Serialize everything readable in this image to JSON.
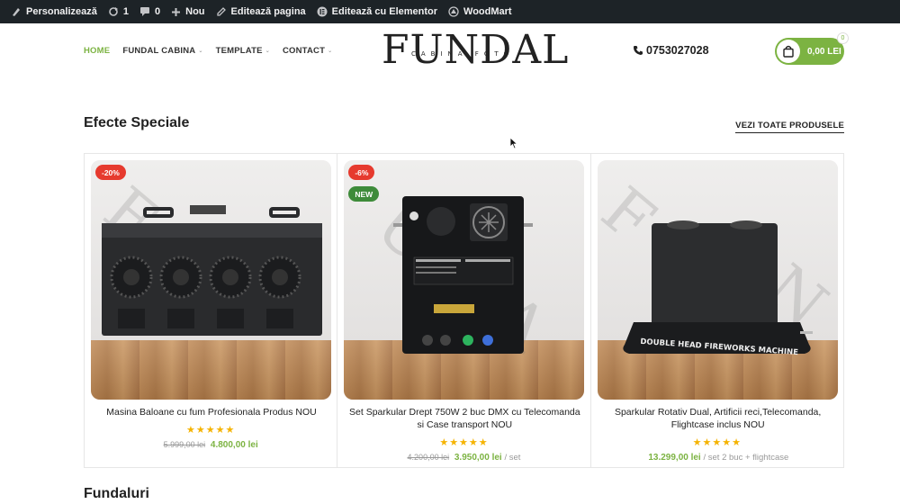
{
  "adminbar": {
    "customize": "Personalizează",
    "updates_count": "1",
    "comments_count": "0",
    "new": "Nou",
    "edit_page": "Editează pagina",
    "edit_elementor": "Editează cu Elementor",
    "woodmart": "WoodMart"
  },
  "nav": {
    "items": [
      {
        "label": "HOME",
        "active": true
      },
      {
        "label": "FUNDAL CABINA",
        "has_dropdown": true
      },
      {
        "label": "TEMPLATE",
        "has_dropdown": true
      },
      {
        "label": "CONTACT",
        "has_dropdown": true
      }
    ]
  },
  "logo": {
    "main": "FUNDAL",
    "sub": "CABINA FOTO"
  },
  "phone": "0753027028",
  "cart": {
    "total": "0,00 LEI",
    "count": "0"
  },
  "section": {
    "title": "Efecte Speciale",
    "view_all": "VEZI TOATE PRODUSELE"
  },
  "products": [
    {
      "badges": [
        "-20%"
      ],
      "title": "Masina Baloane cu fum Profesionala Produs NOU",
      "rating": 5,
      "stars": "★★★★★",
      "old_price": "5.999,00 lei",
      "price": "4.800,00 lei",
      "unit": ""
    },
    {
      "badges": [
        "-6%",
        "NEW"
      ],
      "title": "Set Sparkular Drept 750W 2 buc DMX cu Telecomanda si Case transport NOU",
      "rating": 5,
      "stars": "★★★★★",
      "old_price": "4.200,00 lei",
      "price": "3.950,00 lei",
      "unit": "/ set"
    },
    {
      "badges": [],
      "title": "Sparkular Rotativ Dual, Artificii reci,Telecomanda, Flightcase inclus NOU",
      "rating": 5,
      "stars": "★★★★★",
      "old_price": "",
      "price": "13.299,00 lei",
      "unit": "/ set 2 buc + flightcase"
    }
  ],
  "product_image_text": {
    "machine_label": "DOUBLE HEAD FIREWORKS MACHINE"
  },
  "section2": {
    "title": "Fundaluri"
  },
  "colors": {
    "accent": "#7cb342",
    "sale": "#e63a2e",
    "new": "#3e8b3a",
    "star": "#f5b301",
    "adminbar": "#1d2327"
  }
}
